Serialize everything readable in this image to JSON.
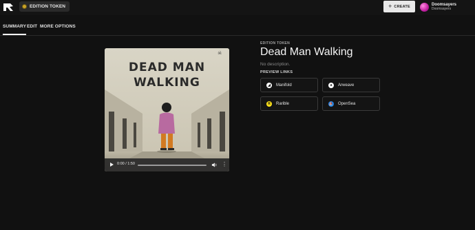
{
  "header": {
    "token_label": "EDITION TOKEN",
    "create_label": "CREATE",
    "account_name": "Doomsayers",
    "account_sub": "Doomsayers"
  },
  "tabs": [
    {
      "label": "SUMMARY"
    },
    {
      "label": "EDIT"
    },
    {
      "label": "MORE OPTIONS"
    }
  ],
  "media": {
    "cover_line1": "DEAD MAN",
    "cover_line2": "WALKING",
    "time": "0:00 / 1:50"
  },
  "info": {
    "eyebrow": "EDITION TOKEN",
    "title": "Dead Man Walking",
    "description": "No description.",
    "preview_label": "PREVIEW LINKS"
  },
  "preview_links": [
    {
      "label": "Manifold",
      "icon": "manifold-icon",
      "color": "#ffffff"
    },
    {
      "label": "Arweave",
      "icon": "arweave-icon",
      "color": "#ffffff"
    },
    {
      "label": "Rarible",
      "icon": "rarible-icon",
      "color": "#ffe21a"
    },
    {
      "label": "OpenSea",
      "icon": "opensea-icon",
      "color": "#2081e2"
    }
  ],
  "colors": {
    "background": "#111111",
    "accent": "#ffffff"
  }
}
